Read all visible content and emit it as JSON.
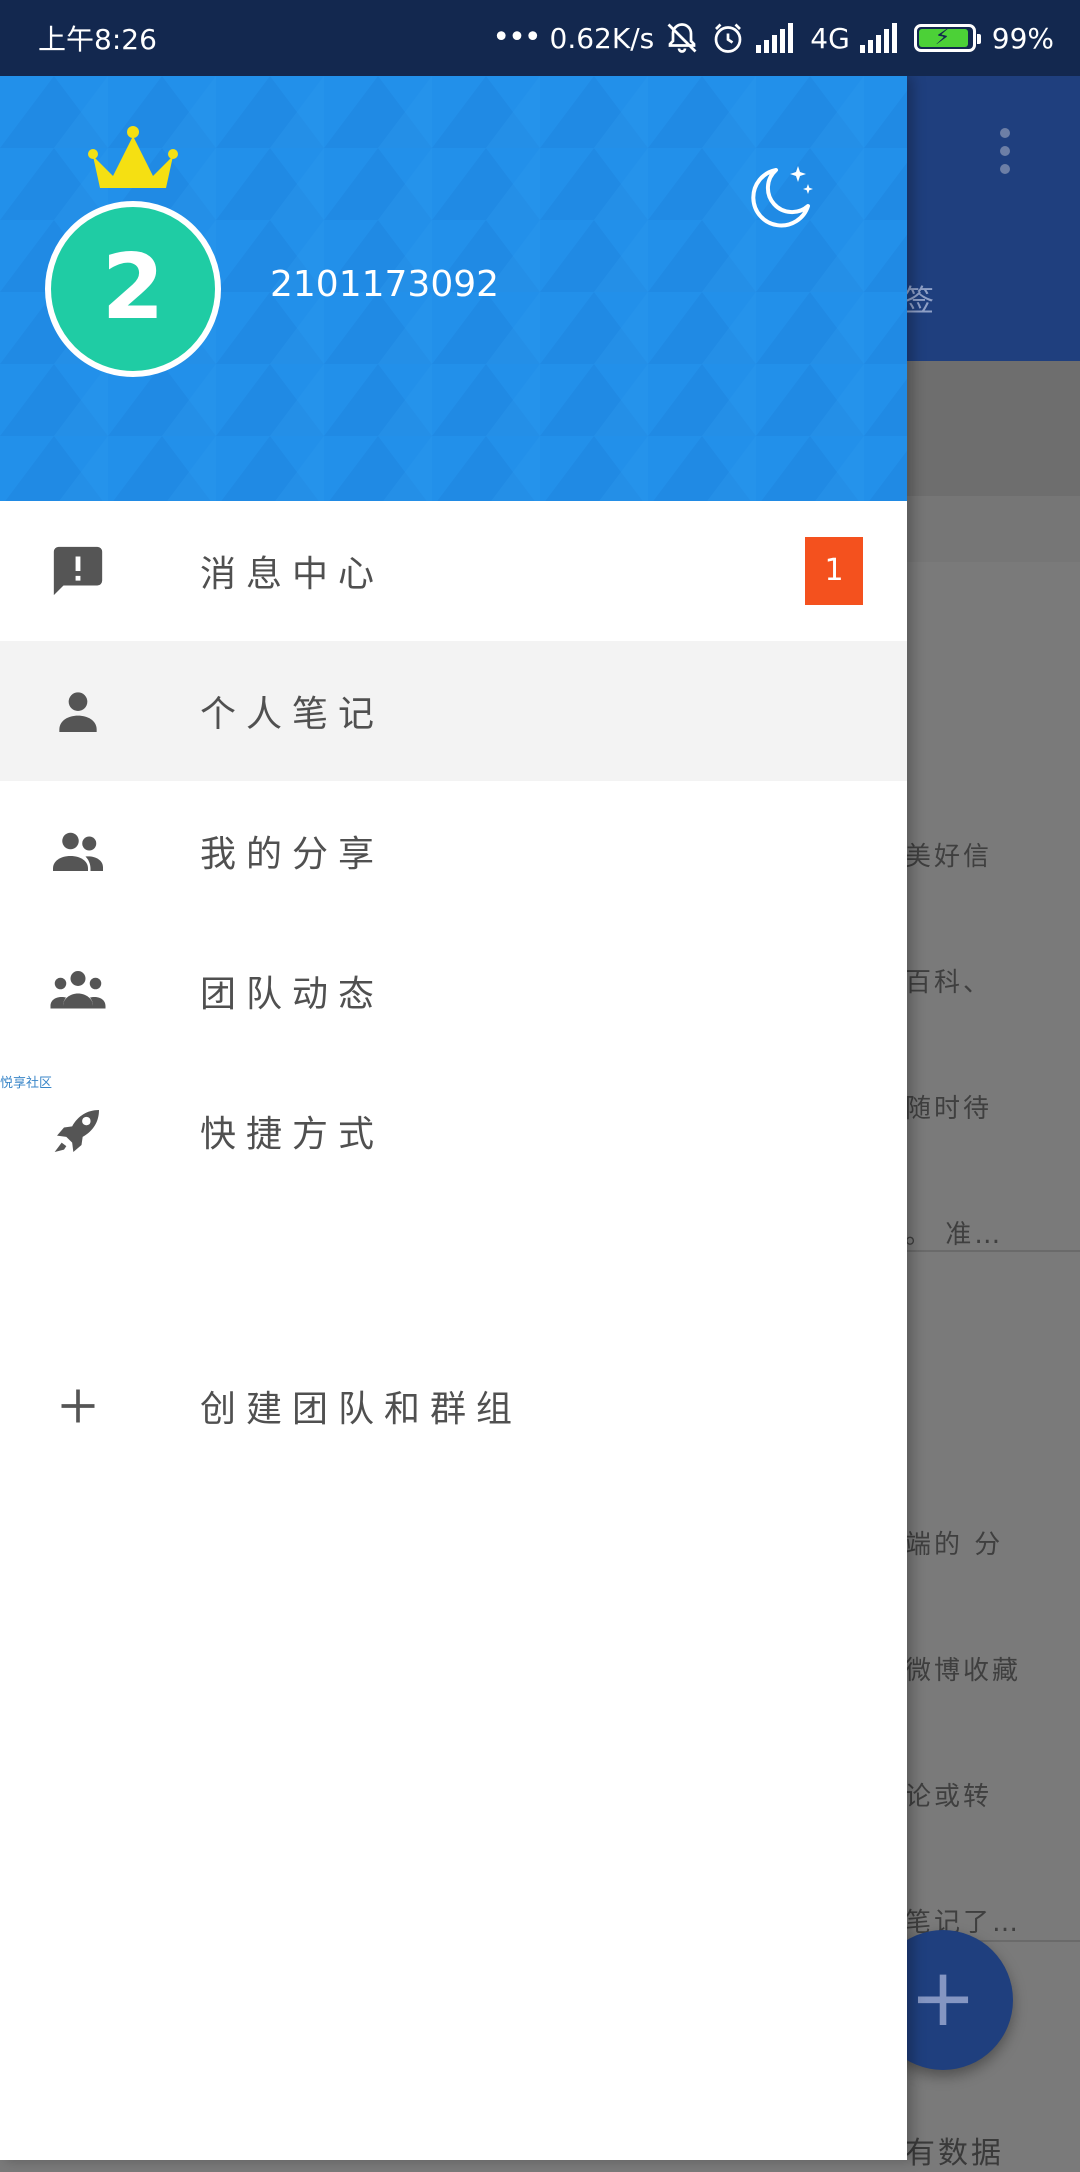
{
  "status_bar": {
    "time": "上午8:26",
    "signal_dots": "•••",
    "speed": "0.62K/s",
    "network": "4G",
    "battery": "99%",
    "battery_level": 0.99
  },
  "background_app": {
    "tab_text": "签",
    "card1_lines": [
      "美好信",
      "百科、",
      "随时待",
      "。 准…"
    ],
    "card2_lines": [
      "端的 分",
      "微博收藏",
      "论或转",
      "笔记了…"
    ],
    "fab_icon": "+",
    "bottom_text": "有数据"
  },
  "drawer": {
    "header": {
      "avatar_text": "2",
      "username": "2101173092",
      "crown_icon": "crown-icon",
      "night_mode_icon": "moon-stars-icon"
    },
    "menu": [
      {
        "label": "消息中心",
        "icon": "message-alert-icon",
        "badge": "1"
      },
      {
        "label": "个人笔记",
        "icon": "person-icon"
      },
      {
        "label": "我的分享",
        "icon": "people-icon"
      },
      {
        "label": "团队动态",
        "icon": "group-icon"
      },
      {
        "label": "快捷方式",
        "icon": "rocket-icon"
      }
    ],
    "watermark": "悦享社区",
    "create": {
      "label": "创建团队和群组",
      "icon": "plus-icon"
    }
  },
  "colors": {
    "status_bar": "#13284f",
    "header_blue": "#2290ea",
    "avatar_green": "#1fcca4",
    "badge_orange": "#f4511e",
    "crown_yellow": "#f5e012"
  }
}
